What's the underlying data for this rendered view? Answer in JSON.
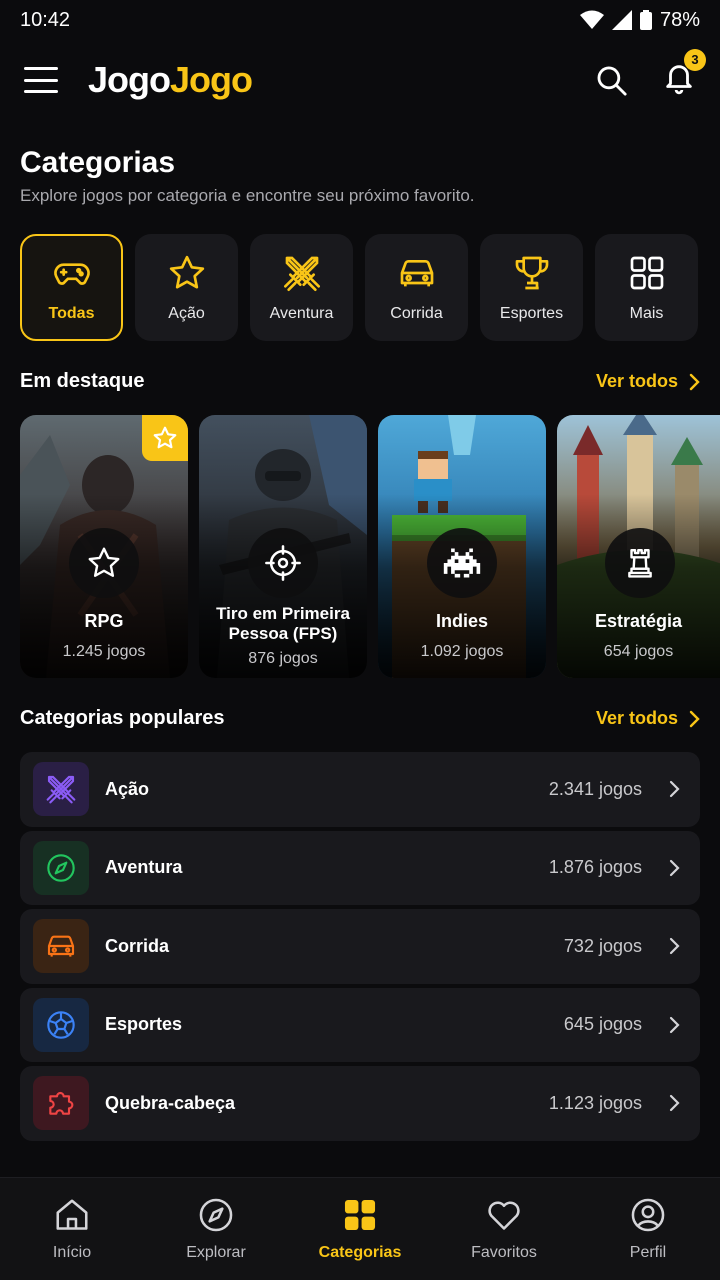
{
  "status": {
    "time": "10:42",
    "battery": "78%"
  },
  "header": {
    "logo_part1": "Jogo",
    "logo_part2": "Jogo",
    "notification_count": "3"
  },
  "page": {
    "title": "Categorias",
    "subtitle": "Explore jogos por categoria e encontre seu próximo favorito."
  },
  "chips": [
    {
      "label": "Todas",
      "icon": "gamepad-icon"
    },
    {
      "label": "Ação",
      "icon": "star-icon"
    },
    {
      "label": "Aventura",
      "icon": "crossed-swords-icon"
    },
    {
      "label": "Corrida",
      "icon": "car-icon"
    },
    {
      "label": "Esportes",
      "icon": "trophy-icon"
    },
    {
      "label": "Mais",
      "icon": "grid-icon"
    }
  ],
  "featured": {
    "title": "Em destaque",
    "see_all": "Ver todos",
    "cards": [
      {
        "name": "RPG",
        "count": "1.245 jogos",
        "icon": "star-icon"
      },
      {
        "name": "Tiro em Primeira Pessoa (FPS)",
        "count": "876 jogos",
        "icon": "crosshair-icon"
      },
      {
        "name": "Indies",
        "count": "1.092 jogos",
        "icon": "space-invader-icon"
      },
      {
        "name": "Estratégia",
        "count": "654 jogos",
        "icon": "chess-rook-icon"
      }
    ]
  },
  "popular": {
    "title": "Categorias populares",
    "see_all": "Ver todos",
    "items": [
      {
        "name": "Ação",
        "count": "2.341 jogos",
        "icon": "crossed-swords-icon",
        "color": "#8b5cf6"
      },
      {
        "name": "Aventura",
        "count": "1.876 jogos",
        "icon": "compass-icon",
        "color": "#22c55e"
      },
      {
        "name": "Corrida",
        "count": "732 jogos",
        "icon": "car-icon",
        "color": "#f97316"
      },
      {
        "name": "Esportes",
        "count": "645 jogos",
        "icon": "soccer-ball-icon",
        "color": "#3b82f6"
      },
      {
        "name": "Quebra-cabeça",
        "count": "1.123 jogos",
        "icon": "puzzle-icon",
        "color": "#ef4444"
      }
    ]
  },
  "nav": [
    {
      "label": "Início",
      "icon": "home-icon"
    },
    {
      "label": "Explorar",
      "icon": "compass-icon"
    },
    {
      "label": "Categorias",
      "icon": "grid-icon",
      "active": true
    },
    {
      "label": "Favoritos",
      "icon": "heart-icon"
    },
    {
      "label": "Perfil",
      "icon": "profile-icon"
    }
  ],
  "colors": {
    "accent": "#f9c517",
    "background": "#0b0b0d",
    "card": "#19191d"
  }
}
